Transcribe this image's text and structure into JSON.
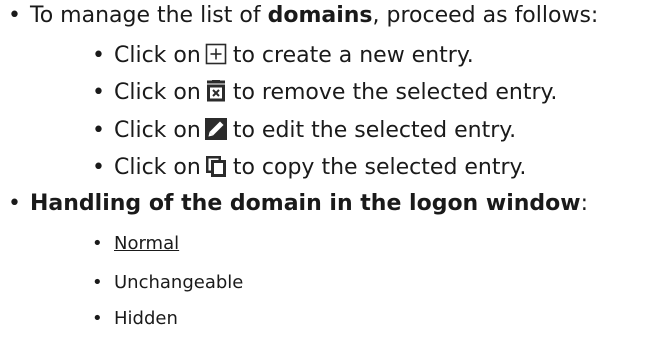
{
  "bullet_char": "•",
  "section1": {
    "intro_prefix": "To manage the list of ",
    "intro_bold": "domains",
    "intro_suffix": ", proceed as follows:",
    "items": [
      {
        "prefix": "Click on",
        "icon": "plus-icon",
        "suffix": "to create a new entry."
      },
      {
        "prefix": "Click on",
        "icon": "delete-icon",
        "suffix": "to remove the selected entry."
      },
      {
        "prefix": "Click on",
        "icon": "edit-icon",
        "suffix": "to edit the selected entry."
      },
      {
        "prefix": "Click on",
        "icon": "copy-icon",
        "suffix": "to copy the selected entry."
      }
    ]
  },
  "section2": {
    "heading_bold": "Handling of the domain in the logon window",
    "heading_suffix": ":",
    "options": [
      {
        "label": "Normal"
      },
      {
        "label": "Unchangeable"
      },
      {
        "label": "Hidden"
      }
    ]
  },
  "colors": {
    "icon_dark": "#2b2b2b",
    "text": "#1a1a1a"
  }
}
